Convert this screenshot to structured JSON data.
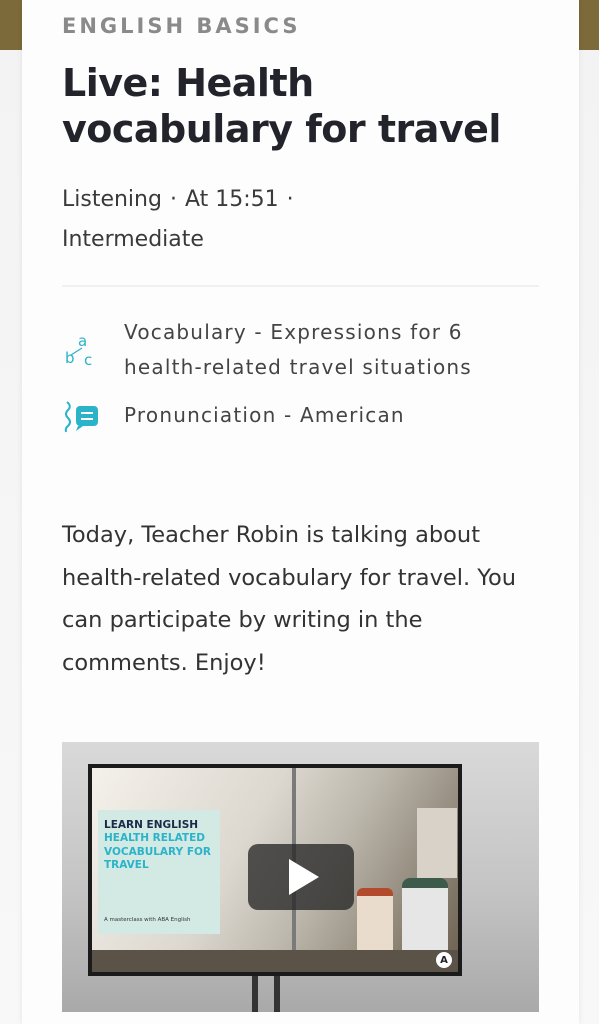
{
  "category": "ENGLISH BASICS",
  "title": "Live: Health vocabulary for travel",
  "meta": {
    "skill": "Listening",
    "separator": "·",
    "time": "At 15:51",
    "level": "Intermediate"
  },
  "features": [
    {
      "icon": "vocabulary-abc-icon",
      "text": "Vocabulary - Expressions for 6 health-related travel situations"
    },
    {
      "icon": "pronunciation-speech-icon",
      "text": "Pronunciation - American"
    }
  ],
  "description": "Today, Teacher Robin is talking about health-related vocabulary for travel. You can participate by writing in the comments. Enjoy!",
  "video": {
    "promo_line1": "LEARN ENGLISH",
    "promo_line2": "HEALTH RELATED VOCABULARY FOR TRAVEL",
    "promo_small": "A masterclass with ABA English",
    "brand_badge": "A",
    "play_icon": "play-icon"
  },
  "colors": {
    "accent": "#2bb3c9",
    "title": "#23232b",
    "header_strip": "#7c6a3b"
  }
}
